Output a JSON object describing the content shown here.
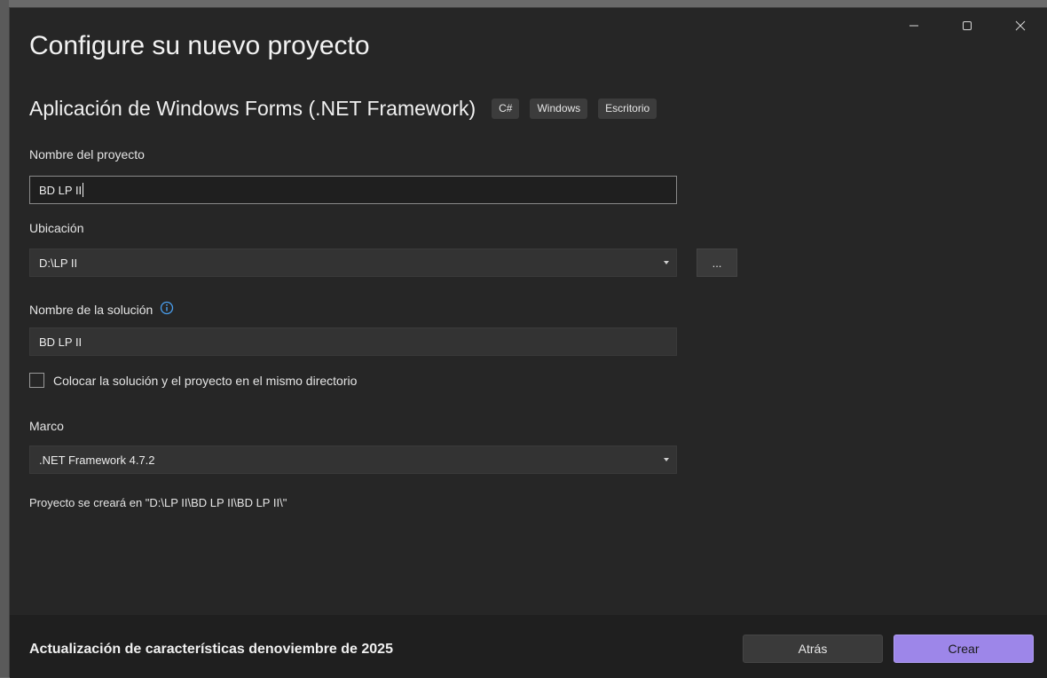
{
  "window": {
    "controls": {
      "minimize": "minimize",
      "maximize": "maximize",
      "close": "close"
    }
  },
  "header": {
    "title": "Configure su nuevo proyecto",
    "template_name": "Aplicación de Windows Forms (.NET Framework)",
    "tags": [
      "C#",
      "Windows",
      "Escritorio"
    ]
  },
  "form": {
    "project_name": {
      "label": "Nombre del proyecto",
      "value": "BD LP II"
    },
    "location": {
      "label": "Ubicación",
      "value": "D:\\LP II",
      "browse_label": "..."
    },
    "solution_name": {
      "label": "Nombre de la solución",
      "value": "BD LP II",
      "icon": "info-icon"
    },
    "same_dir": {
      "label": "Colocar la solución y el proyecto en el mismo directorio",
      "checked": false
    },
    "framework": {
      "label": "Marco",
      "value": ".NET Framework 4.7.2"
    },
    "path_note": "Proyecto se creará en \"D:\\LP II\\BD LP II\\BD LP II\\\""
  },
  "footer": {
    "update_text": "Actualización de características denoviembre de 2025",
    "back_label": "Atrás",
    "create_label": "Crear"
  },
  "colors": {
    "background": "#262626",
    "footer": "#1f1f1f",
    "accent": "#9d86e9"
  }
}
